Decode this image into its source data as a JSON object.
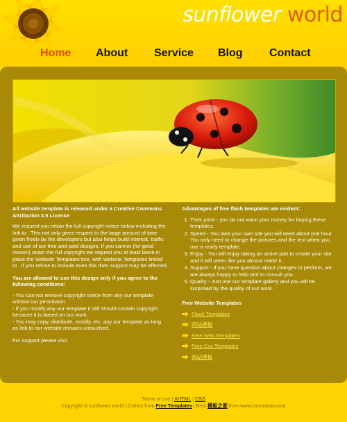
{
  "header": {
    "logo_part1": "sunflower",
    "logo_part2": "world",
    "nav": [
      "Home",
      "About",
      "Service",
      "Blog",
      "Contact"
    ]
  },
  "content": {
    "left": {
      "heading1": "All website template is released under a Creative Commons Attribution 2.5 License",
      "para1": "We request you retain the full copyright notice below including the link to . This not only gives respect to the large amount of time given freely by the developers but also helps build interest, traffic and use of our free and paid designs. If you cannot (for good reason) retain the full copyright we request you at least leave in place the Website Templates line, with Website Templates linked to . If you refuse to include even this then support may be affected.",
      "heading2": "You are allowed to use this design only if you agree to the following conditions:",
      "conditions": [
        "- You can not remove copyright notice from any our template without our permission.",
        "- If you modify any our template it still should contain copyright because it is based on our work.",
        "- You may copy, distribute, modify, etc. any our template as long as link to our website remains untouched."
      ],
      "support": "For support please visit"
    },
    "right": {
      "heading1": "Advantages of free flash templates are evident:",
      "advantages": [
        "Their price - you do not waist your money for buying these templates.",
        "Speed - You take your own site you will need about one hour. You only need to change the pictures and the text when you use a ready template.",
        "Enjoy - You will enjoy taking an active part to create your site and it will seem like you almost made it.",
        "Support - If you have question about changes to perform, we are always happy to help and to consult you.",
        "Quality - Just use our template gallery and you will be surprised by the quality of our work."
      ],
      "heading2": "Free Website Templates",
      "links": [
        "Flash Templates",
        "网站模板",
        "Free Web Templates",
        "Free Css Templates",
        "网站模板"
      ]
    }
  },
  "footer": {
    "line1_prefix": "Terms of use | ",
    "xhtml": "XHTML",
    "sep": " | ",
    "css": "CSS",
    "copyright": "Copyright © sunflower world | Collect from ",
    "free_templates": "Free Templates",
    "best": " | Best ",
    "cn_link": "模板之家",
    "from": " from www.cssmoban.com"
  },
  "colors": {
    "page_bg": "#ffd400",
    "panel_bg": "#a88a08",
    "logo_accent": "#e05a00",
    "link": "#ffe54a"
  }
}
